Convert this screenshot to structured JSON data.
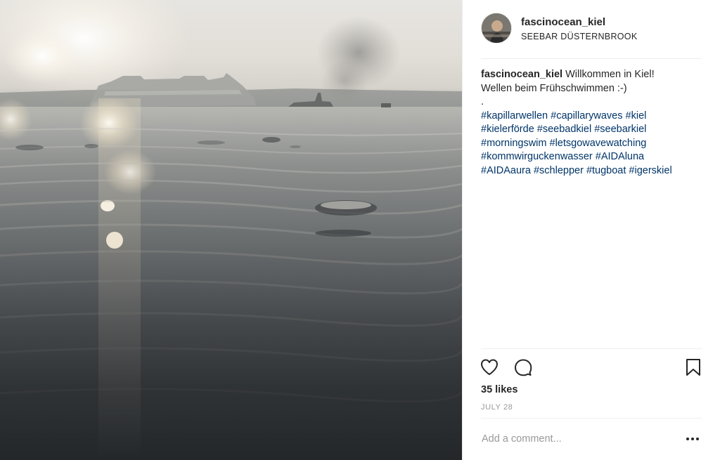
{
  "post": {
    "photo_alt": "",
    "author": {
      "username": "fascinocean_kiel",
      "location": "SEEBAR DÜSTERNBROOK"
    },
    "caption": {
      "username": "fascinocean_kiel",
      "line1": "Willkommen in Kiel!",
      "line2": "Wellen beim Frühschwimmen :-)",
      "separator": ".",
      "hashtag_lines": [
        [
          "#kapillarwellen",
          "#capillarywaves",
          "#kiel"
        ],
        [
          "#kielerförde",
          "#seebadkiel",
          "#seebarkiel"
        ],
        [
          "#morningswim",
          "#letsgowavewatching"
        ],
        [
          "#kommwirguckenwasser",
          "#AIDAluna"
        ],
        [
          "#AIDAaura",
          "#schlepper",
          "#tugboat",
          "#igerskiel"
        ]
      ]
    },
    "likes_text": "35 likes",
    "date_text": "JULY 28",
    "comment": {
      "placeholder": "Add a comment...",
      "value": ""
    },
    "icons": {
      "like": "heart-icon",
      "comment": "comment-bubble-icon",
      "save": "bookmark-icon",
      "more": "more-options-icon"
    },
    "colors": {
      "hashtag": "#003569",
      "text": "#262626",
      "muted": "#999999",
      "divider": "#efefef"
    }
  }
}
